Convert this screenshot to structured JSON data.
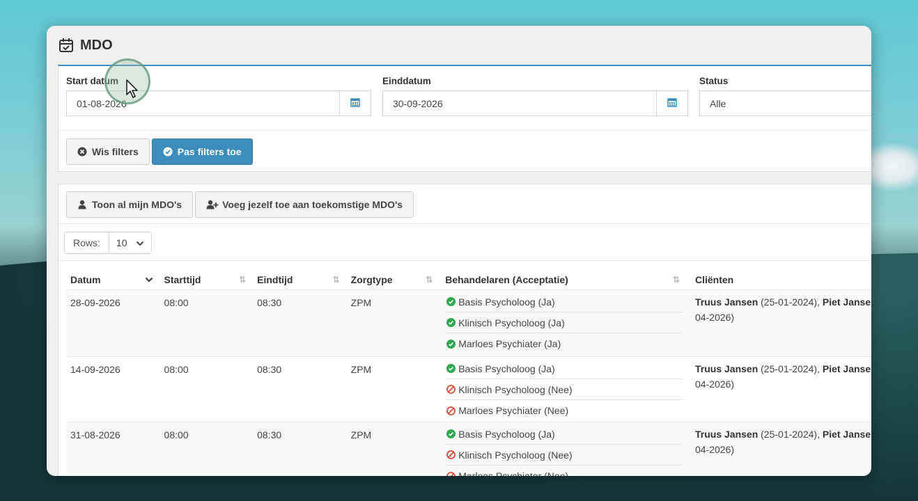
{
  "window": {
    "title": "MDO"
  },
  "filters": {
    "start": {
      "label": "Start datum",
      "value": "01-08-2026"
    },
    "end": {
      "label": "Einddatum",
      "value": "30-09-2026"
    },
    "status": {
      "label": "Status",
      "value": "Alle"
    },
    "clear_label": "Wis filters",
    "apply_label": "Pas filters toe"
  },
  "actions": {
    "show_mine_label": "Toon al mijn MDO's",
    "join_future_label": "Voeg jezelf toe aan toekomstige MDO's"
  },
  "rows_control": {
    "label": "Rows:",
    "value": "10"
  },
  "table": {
    "headers": {
      "datum": "Datum",
      "starttijd": "Starttijd",
      "eindtijd": "Eindtijd",
      "zorgtype": "Zorgtype",
      "behandelaren": "Behandelaren (Acceptatie)",
      "clienten": "Cliënten"
    },
    "rows": [
      {
        "datum": "28-09-2026",
        "start": "08:00",
        "eind": "08:30",
        "zorg": "ZPM",
        "beh": [
          {
            "text": "Basis Psycholoog (Ja)",
            "status": "ok"
          },
          {
            "text": "Klinisch Psycholoog (Ja)",
            "status": "ok"
          },
          {
            "text": "Marloes Psychiater (Ja)",
            "status": "ok"
          }
        ],
        "client1_name": "Truus Jansen",
        "client1_date": " (25-01-2024), ",
        "client2_name": "Piet Jansen",
        "client_cont": "04-2026)"
      },
      {
        "datum": "14-09-2026",
        "start": "08:00",
        "eind": "08:30",
        "zorg": "ZPM",
        "beh": [
          {
            "text": "Basis Psycholoog (Ja)",
            "status": "ok"
          },
          {
            "text": "Klinisch Psycholoog (Nee)",
            "status": "no"
          },
          {
            "text": "Marloes Psychiater (Nee)",
            "status": "no"
          }
        ],
        "client1_name": "Truus Jansen",
        "client1_date": " (25-01-2024), ",
        "client2_name": "Piet Jansen",
        "client_cont": "04-2026)"
      },
      {
        "datum": "31-08-2026",
        "start": "08:00",
        "eind": "08:30",
        "zorg": "ZPM",
        "beh": [
          {
            "text": "Basis Psycholoog (Ja)",
            "status": "ok"
          },
          {
            "text": "Klinisch Psycholoog (Nee)",
            "status": "no"
          },
          {
            "text": "Marloes Psychiater (Nee)",
            "status": "no"
          }
        ],
        "client1_name": "Truus Jansen",
        "client1_date": " (25-01-2024), ",
        "client2_name": "Piet Jansen",
        "client_cont": "04-2026)"
      }
    ]
  },
  "colors": {
    "primary": "#3c8dbc",
    "ok": "#2fa84f",
    "no": "#dd4b39"
  },
  "icons": [
    "calendar-check-icon",
    "calendar-icon",
    "times-circle-icon",
    "check-circle-icon",
    "user-icon",
    "user-plus-icon",
    "chevron-down-icon",
    "sort-icon",
    "ban-icon",
    "mouse-cursor-icon"
  ]
}
